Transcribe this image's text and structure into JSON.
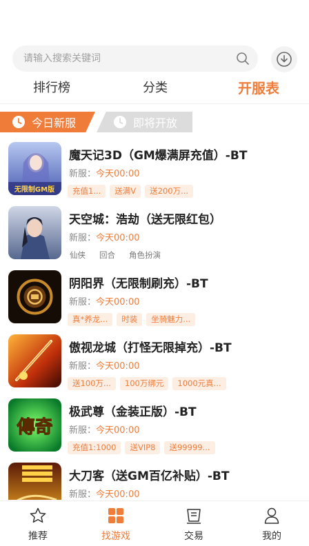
{
  "search": {
    "placeholder": "请输入搜索关键词"
  },
  "tabs": [
    {
      "label": "排行榜"
    },
    {
      "label": "分类"
    },
    {
      "label": "开服表"
    }
  ],
  "subtabs": {
    "today": "今日新服",
    "soon": "即将开放"
  },
  "games": [
    {
      "name": "魔天记3D（GM爆满屏充值）-BT",
      "server_label": "新服：",
      "time": "今天00:00",
      "tags": [
        "充值1...",
        "送满V",
        "送200万..."
      ],
      "plain": false
    },
    {
      "name": "天空城：浩劫（送无限红包）",
      "server_label": "新服：",
      "time": "今天00:00",
      "tags": [
        "仙侠",
        "回合",
        "角色扮演"
      ],
      "plain": true
    },
    {
      "name": "阴阳界（无限制刷充）-BT",
      "server_label": "新服：",
      "time": "今天00:00",
      "tags": [
        "真*养龙...",
        "时装",
        "坐骑魅力..."
      ],
      "plain": false
    },
    {
      "name": "傲视龙城（打怪无限掉充）-BT",
      "server_label": "新服：",
      "time": "今天00:00",
      "tags": [
        "送100万...",
        "100万绑元",
        "1000元真..."
      ],
      "plain": false
    },
    {
      "name": "极武尊（金装正版）-BT",
      "server_label": "新服：",
      "time": "今天00:00",
      "tags": [
        "充值1:1000",
        "送VIP8",
        "送99999..."
      ],
      "plain": false
    },
    {
      "name": "大刀客（送GM百亿补贴）-BT",
      "server_label": "新服：",
      "time": "今天00:00",
      "tags": [],
      "plain": false
    }
  ],
  "icon_text": {
    "game1_badge": "无限制GM版",
    "game5_glyph": "傳奇"
  },
  "nav": [
    {
      "label": "推荐",
      "icon": "star-icon"
    },
    {
      "label": "找游戏",
      "icon": "grid-icon"
    },
    {
      "label": "交易",
      "icon": "receipt-icon"
    },
    {
      "label": "我的",
      "icon": "user-icon"
    }
  ],
  "colors": {
    "accent": "#f07c3a",
    "tag_bg": "#fdeee4"
  }
}
